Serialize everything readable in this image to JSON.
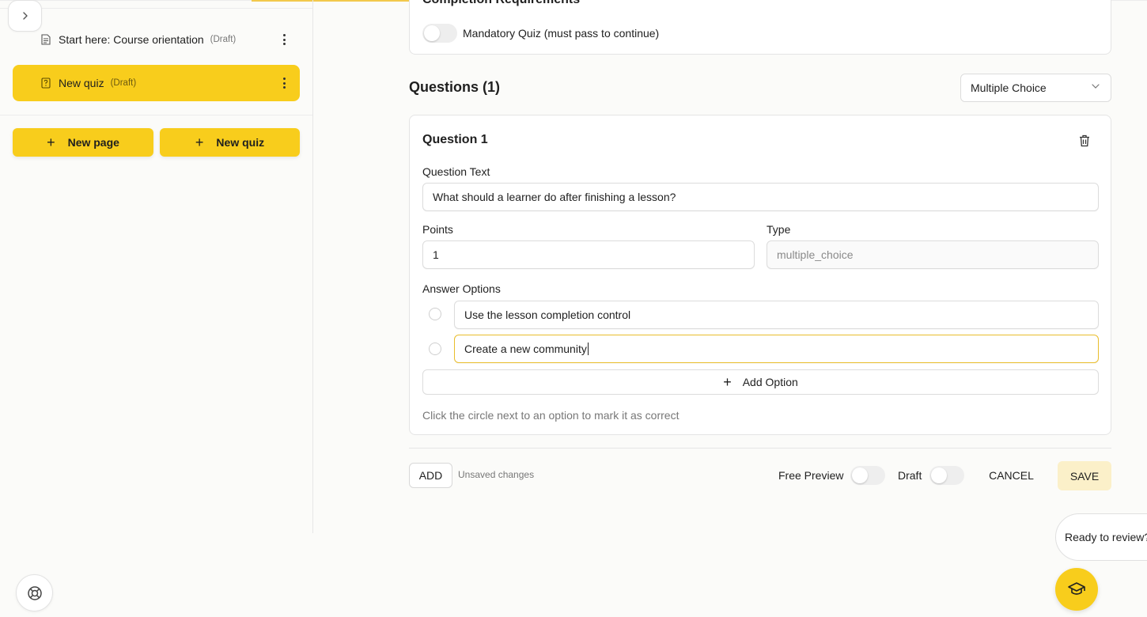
{
  "sidebar": {
    "items": [
      {
        "title": "Start here: Course orientation",
        "status": "(Draft)",
        "icon": "page-icon",
        "active": false
      },
      {
        "title": "New quiz",
        "status": "(Draft)",
        "icon": "quiz-icon",
        "active": true
      }
    ],
    "new_page_label": "New page",
    "new_quiz_label": "New quiz"
  },
  "completion": {
    "title": "Completion Requirements",
    "mandatory_label": "Mandatory Quiz (must pass to continue)"
  },
  "questions": {
    "heading": "Questions (1)",
    "type_select": "Multiple Choice",
    "question": {
      "title": "Question 1",
      "text_label": "Question Text",
      "text_value": "What should a learner do after finishing a lesson?",
      "points_label": "Points",
      "points_value": "1",
      "type_label": "Type",
      "type_value": "multiple_choice",
      "options_label": "Answer Options",
      "options": [
        "Use the lesson completion control",
        "Create a new community"
      ],
      "add_option_label": "Add Option",
      "hint": "Click the circle next to an option to mark it as correct"
    }
  },
  "footer": {
    "add_label": "ADD",
    "unsaved": "Unsaved changes",
    "free_preview_label": "Free Preview",
    "draft_label": "Draft",
    "cancel_label": "CANCEL",
    "save_label": "SAVE"
  },
  "assistant": {
    "bubble": "Ready to review?"
  },
  "colors": {
    "accent": "#f8cd1c",
    "save_bg": "#fbf0c9",
    "focus_border": "#e9bd2c"
  }
}
